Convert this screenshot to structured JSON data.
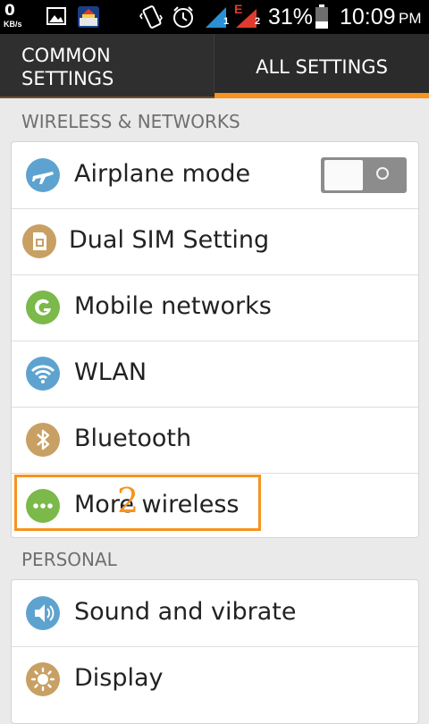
{
  "status_bar": {
    "speed_value": "0",
    "speed_unit": "KB/s",
    "battery_percent": "31%",
    "time": "10:09",
    "ampm": "PM",
    "sim1_badge": "1",
    "sim2_network_type": "E",
    "sim2_badge": "2",
    "icons": [
      "image-icon",
      "app-notification-icon",
      "vibrate-icon",
      "alarm-icon",
      "signal-sim1-icon",
      "signal-sim2-icon",
      "battery-icon"
    ]
  },
  "tabs": {
    "common_line1": "COMMON",
    "common_line2": "SETTINGS",
    "all": "ALL SETTINGS",
    "selected": "ALL SETTINGS"
  },
  "sections": {
    "wireless": {
      "header": "WIRELESS & NETWORKS",
      "items": [
        {
          "label": "Airplane mode",
          "icon": "airplane-icon",
          "color": "#5ea3cf",
          "toggle": "off"
        },
        {
          "label": "Dual SIM Setting",
          "icon": "sim-card-icon",
          "color": "#c8a064"
        },
        {
          "label": "Mobile networks",
          "icon": "mobile-networks-icon",
          "color": "#7bb94a"
        },
        {
          "label": "WLAN",
          "icon": "wifi-icon",
          "color": "#5ea3cf"
        },
        {
          "label": "Bluetooth",
          "icon": "bluetooth-icon",
          "color": "#c8a064"
        },
        {
          "label": "More wireless",
          "icon": "more-icon",
          "color": "#7bb94a"
        }
      ]
    },
    "personal": {
      "header": "PERSONAL",
      "items": [
        {
          "label": "Sound and vibrate",
          "icon": "speaker-icon",
          "color": "#5ea3cf"
        },
        {
          "label": "Display",
          "icon": "brightness-icon",
          "color": "#c8a064"
        }
      ]
    }
  },
  "annotation": {
    "marker": "2",
    "color": "#f7931e"
  },
  "colors": {
    "accent": "#f7931e",
    "tab_background": "#2b2b2b",
    "page_background": "#eaeaea"
  }
}
